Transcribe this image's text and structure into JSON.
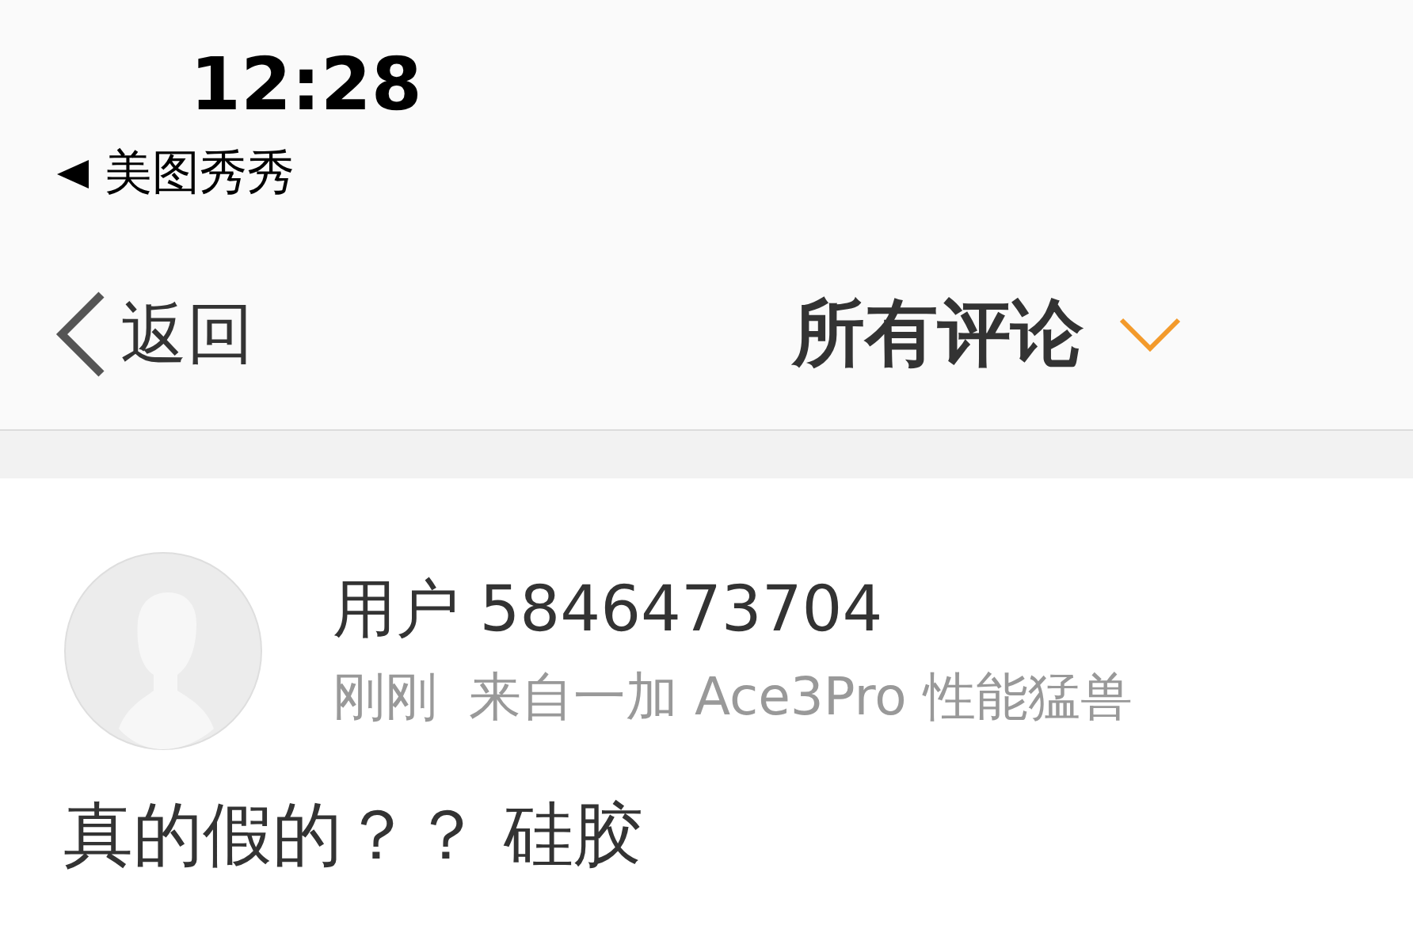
{
  "status_bar": {
    "time": "12:28",
    "back_app": "美图秀秀"
  },
  "nav_bar": {
    "back": "返回",
    "title": "所有评论"
  },
  "comment": {
    "user": "用户 5846473704",
    "time": "刚刚",
    "source": "来自一加 Ace3Pro 性能猛兽",
    "text": "真的假的？？ 硅胶"
  }
}
